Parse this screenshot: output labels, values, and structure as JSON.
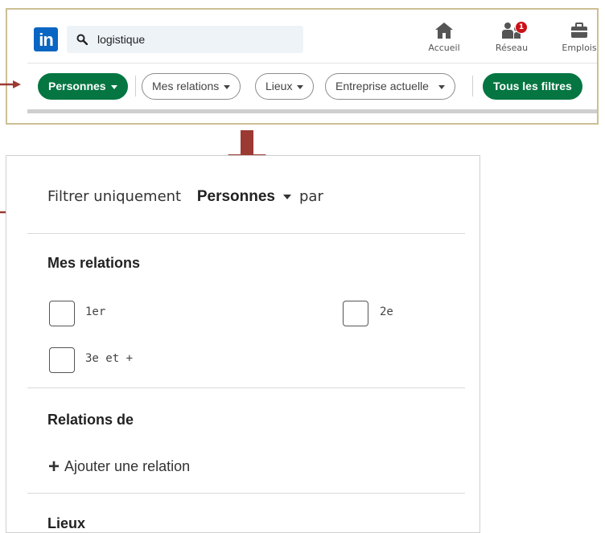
{
  "header": {
    "search": {
      "value": "logistique"
    },
    "nav": [
      {
        "label": "Accueil",
        "icon": "home-icon"
      },
      {
        "label": "Réseau",
        "icon": "network-icon",
        "badge": "1"
      },
      {
        "label": "Emplois",
        "icon": "briefcase-icon"
      }
    ],
    "filters": {
      "type_chip": "Personnes",
      "chips": [
        "Mes relations",
        "Lieux",
        "Entreprise actuelle"
      ],
      "all_filters": "Tous les filtres"
    }
  },
  "panel": {
    "filter_prefix": "Filtrer uniquement",
    "filter_type": "Personnes",
    "filter_suffix": "par",
    "sections": {
      "relations": {
        "title": "Mes relations",
        "options": [
          "1er",
          "2e",
          "3e et +"
        ]
      },
      "relations_de": {
        "title": "Relations de",
        "add_label": "Ajouter une relation"
      },
      "lieux": {
        "title": "Lieux"
      }
    }
  },
  "colors": {
    "brand_blue": "#0a66c2",
    "chip_green": "#057642",
    "arrow_red": "#9b3a32",
    "badge_red": "#cc1016"
  }
}
